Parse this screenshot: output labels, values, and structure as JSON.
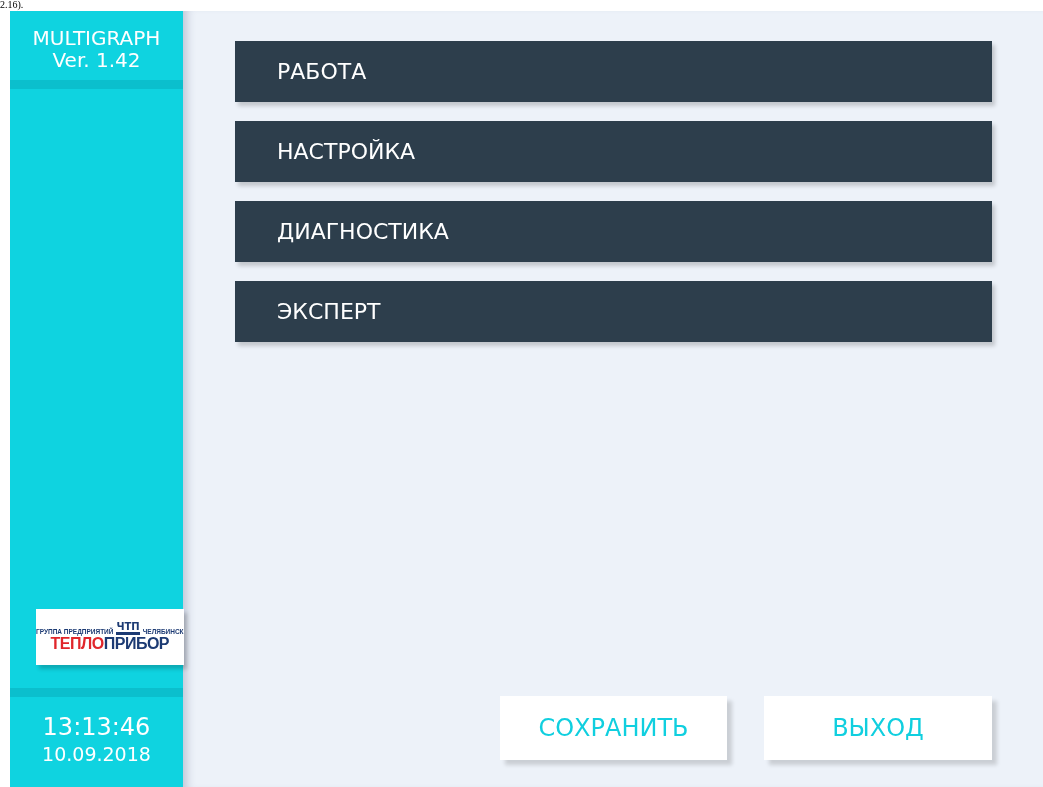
{
  "caption_fragment": "2.16).",
  "sidebar": {
    "product": "MULTIGRAPH",
    "version": "Ver. 1.42",
    "logo": {
      "group": "ГРУППА ПРЕДПРИЯТИЙ",
      "emblem": "ЧТП",
      "city": "ЧЕЛЯБИНСК",
      "brand_first": "ТЕПЛО",
      "brand_second": "ПРИБОР"
    },
    "time": "13:13:46",
    "date": "10.09.2018"
  },
  "menu": [
    {
      "label": "РАБОТА"
    },
    {
      "label": "НАСТРОЙКА"
    },
    {
      "label": "ДИАГНОСТИКА"
    },
    {
      "label": "ЭКСПЕРТ"
    }
  ],
  "buttons": [
    {
      "label": "СОХРАНИТЬ"
    },
    {
      "label": "ВЫХОД"
    }
  ]
}
